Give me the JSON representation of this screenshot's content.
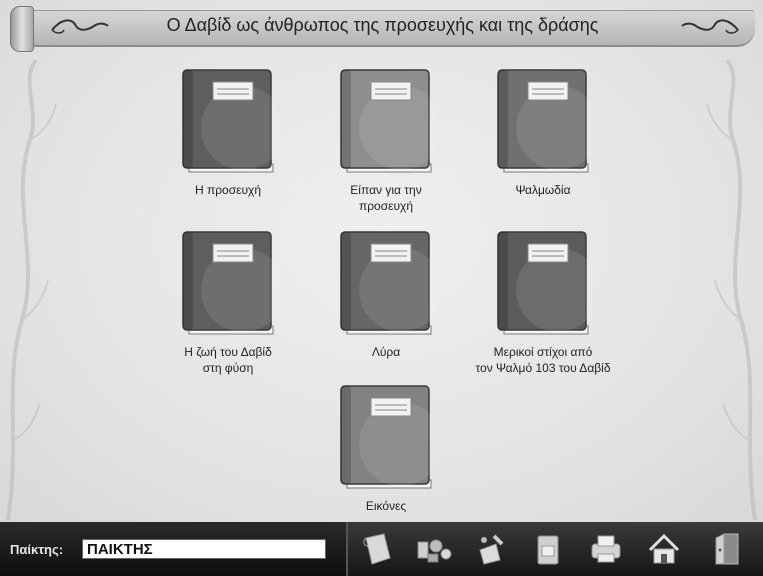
{
  "title": "Ο Δαβίδ ως άνθρωπος της προσευχής και της δράσης",
  "books": [
    {
      "label": "Η προσευχή",
      "shade": "#5e5e5e"
    },
    {
      "label": "Είπαν για την\nπροσευχή",
      "shade": "#8e8e8e"
    },
    {
      "label": "Ψαλμωδία",
      "shade": "#707070"
    },
    {
      "label": "Η ζωή του Δαβίδ\nστη φύση",
      "shade": "#5e5e5e"
    },
    {
      "label": "Λύρα",
      "shade": "#666666"
    },
    {
      "label": "Μερικοί στίχοι από\nτον Ψαλμό 103 του Δαβίδ",
      "shade": "#5c5c5c"
    },
    {
      "label": "Εικόνες",
      "shade": "#828282"
    }
  ],
  "player": {
    "label": "Παίκτης:",
    "value": "ΠΑΙΚΤΗΣ"
  },
  "toolbar": [
    {
      "icon": "scroll-icon"
    },
    {
      "icon": "tools-icon"
    },
    {
      "icon": "paint-icon"
    },
    {
      "icon": "book-icon"
    },
    {
      "icon": "printer-icon"
    },
    {
      "icon": "home-icon"
    },
    {
      "icon": "exit-door-icon"
    }
  ]
}
